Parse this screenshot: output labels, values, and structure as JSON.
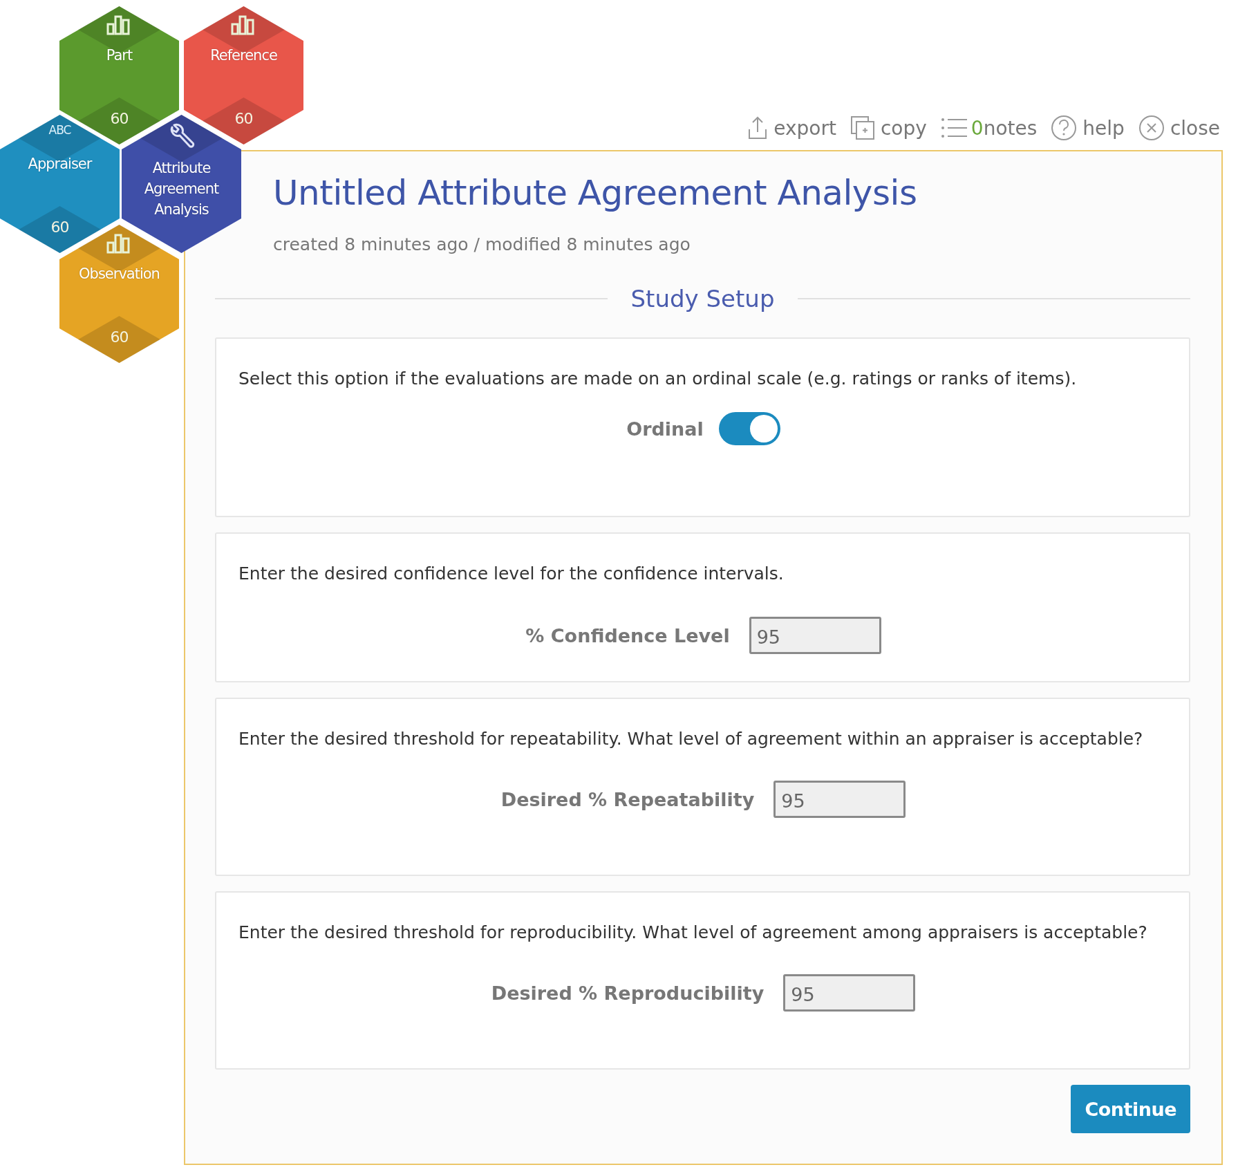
{
  "tiles": [
    {
      "kind": "chart",
      "label": "Part",
      "count": "60",
      "color": "#5b9a2d"
    },
    {
      "kind": "chart",
      "label": "Reference",
      "count": "60",
      "color": "#e8564a"
    },
    {
      "kind": "text",
      "icon_text": "ABC",
      "label": "Appraiser",
      "count": "60",
      "color": "#1f8fbf"
    },
    {
      "kind": "wrench",
      "label": "Attribute Agreement Analysis",
      "color": "#3f4fa8"
    },
    {
      "kind": "chart",
      "label": "Observation",
      "count": "60",
      "color": "#e5a424"
    }
  ],
  "toolbar": [
    {
      "kind": "export",
      "label": "export"
    },
    {
      "kind": "copy",
      "label": "copy"
    },
    {
      "kind": "notes",
      "count": "0",
      "label": "notes"
    },
    {
      "kind": "help",
      "label": "help"
    },
    {
      "kind": "close",
      "label": "close"
    }
  ],
  "title": "Untitled Attribute Agreement Analysis",
  "subtitle": "created 8 minutes ago / modified 8 minutes ago",
  "section_title": "Study Setup",
  "cards": [
    {
      "kind": "toggle",
      "description": "Select this option if the evaluations are made on an ordinal scale (e.g. ratings or ranks of items).",
      "label": "Ordinal",
      "on": true
    },
    {
      "kind": "input",
      "description": "Enter the desired confidence level for the confidence intervals.",
      "label": "% Confidence Level",
      "value": "95"
    },
    {
      "kind": "input",
      "description": "Enter the desired threshold for repeatability. What level of agreement within an appraiser is acceptable?",
      "label": "Desired % Repeatability",
      "value": "95"
    },
    {
      "kind": "input",
      "description": "Enter the desired threshold for reproducibility. What level of agreement among appraisers is acceptable?",
      "label": "Desired % Reproducibility",
      "value": "95"
    }
  ],
  "continue_button": "Continue"
}
